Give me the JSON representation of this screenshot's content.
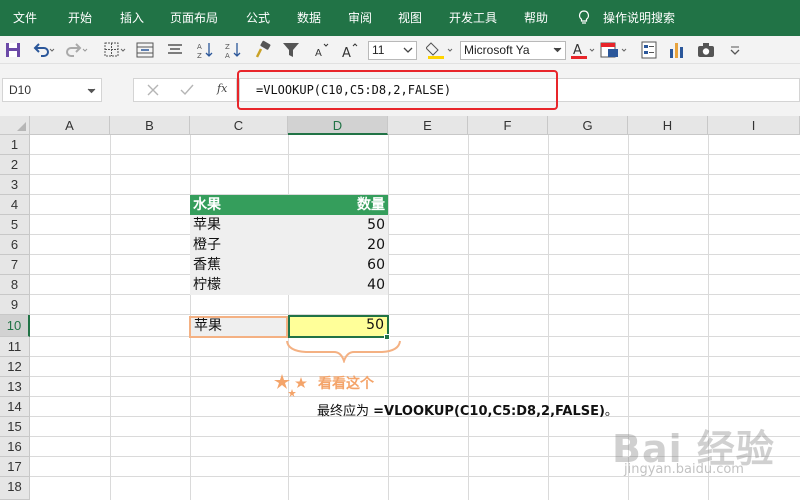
{
  "menu": {
    "items": [
      "文件",
      "开始",
      "插入",
      "页面布局",
      "公式",
      "数据",
      "审阅",
      "视图",
      "开发工具",
      "帮助"
    ],
    "tell_me": "操作说明搜索"
  },
  "toolbar": {
    "font_size": "11",
    "font_name": "Microsoft Ya",
    "font_color": "#e8252a",
    "fill_color": "#ffd400",
    "icons": [
      "save-icon",
      "undo-icon",
      "redo-icon",
      "borders-icon",
      "merge-icon",
      "align-icon",
      "sort-ascending-icon",
      "sort-descending-icon",
      "format-painter-icon",
      "filter-icon",
      "decrease-font-icon",
      "increase-font-icon",
      "fill-color-icon",
      "font-color-icon",
      "cell-style-icon",
      "form-icon",
      "chart-icon",
      "camera-icon",
      "customize-icon"
    ]
  },
  "formula_bar": {
    "name_box": "D10",
    "fx": "fx",
    "formula": "=VLOOKUP(C10,C5:D8,2,FALSE)"
  },
  "grid": {
    "columns": [
      "A",
      "B",
      "C",
      "D",
      "E",
      "F",
      "G",
      "H",
      "I"
    ],
    "selected_column": "D",
    "rows": [
      "1",
      "2",
      "3",
      "4",
      "5",
      "6",
      "7",
      "8",
      "9",
      "10",
      "11",
      "12",
      "13",
      "14",
      "15",
      "16",
      "17",
      "18"
    ],
    "selected_row": "10"
  },
  "table": {
    "header": [
      "水果",
      "数量"
    ],
    "rows": [
      [
        "苹果",
        "50"
      ],
      [
        "橙子",
        "20"
      ],
      [
        "香蕉",
        "60"
      ],
      [
        "柠檬",
        "40"
      ]
    ],
    "header_color": "#359e5c"
  },
  "lookup": {
    "key": "苹果",
    "result": "50"
  },
  "annotation": {
    "label": "看看这个",
    "note_prefix": "最终应为 ",
    "note_formula": "=VLOOKUP(C10,C5:D8,2,FALSE)",
    "note_suffix": "。"
  },
  "watermark": {
    "main": "Bai 经验",
    "sub": "jingyan.baidu.com"
  },
  "colors": {
    "ribbon": "#217346",
    "highlight_box": "#e8252a",
    "active_cell_fill": "#ffff99",
    "lookup_border": "#f4b183",
    "annotation": "#f4a46a"
  }
}
